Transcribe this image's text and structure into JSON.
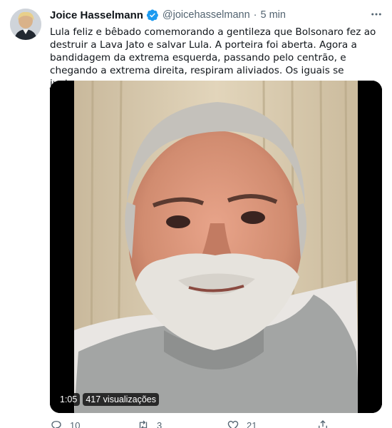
{
  "tweet": {
    "author_name": "Joice Hasselmann",
    "handle": "@joicehasselmann",
    "separator": "·",
    "time": "5 min",
    "text": "Lula feliz e bêbado comemorando a gentileza que Bolsonaro fez ao destruir a Lava Jato e salvar Lula. A porteira foi aberta. Agora a bandidagem da extrema esquerda, passando pelo centrão, e chegando a extrema direita, respiram aliviados. Os iguais se juntam, sempre"
  },
  "video": {
    "duration": "1:05",
    "views": "417 visualizações"
  },
  "actions": {
    "reply_count": "10",
    "retweet_count": "3",
    "like_count": "21"
  },
  "colors": {
    "verified": "#1d9bf0",
    "secondary_text": "#536471"
  }
}
